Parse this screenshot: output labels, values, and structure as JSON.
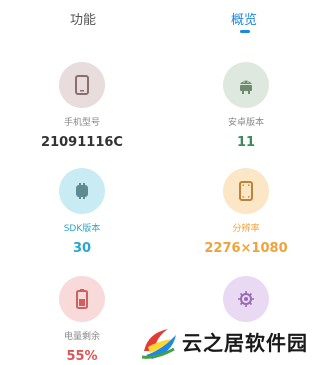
{
  "tabs": [
    {
      "label": "功能",
      "active": false
    },
    {
      "label": "概览",
      "active": true
    }
  ],
  "accent_color": "#1e88e5",
  "items": [
    {
      "id": "model",
      "label": "手机型号",
      "value": "21091116C",
      "icon": "phone-icon",
      "circle_color": "#e8dcdc",
      "icon_color": "#8a6f6f",
      "value_color": "#333333"
    },
    {
      "id": "android",
      "label": "安卓版本",
      "value": "11",
      "icon": "android-icon",
      "circle_color": "#dfe8df",
      "icon_color": "#6f8a6f",
      "value_color": "#3d8a5a"
    },
    {
      "id": "sdk",
      "label": "SDK版本",
      "value": "30",
      "icon": "sdk-icon",
      "circle_color": "#c9ecf4",
      "icon_color": "#5f8a92",
      "value_color": "#2aa7c9"
    },
    {
      "id": "resolution",
      "label": "分辨率",
      "value": "2276×1080",
      "icon": "screen-icon",
      "circle_color": "#fbe6c6",
      "icon_color": "#b9853a",
      "value_color": "#f0a23a"
    },
    {
      "id": "battery",
      "label": "电量剩余",
      "value": "55%",
      "icon": "battery-icon",
      "circle_color": "#f8dada",
      "icon_color": "#d06060",
      "value_color": "#e05454"
    },
    {
      "id": "cpu",
      "label": "",
      "value": "",
      "icon": "cpu-icon",
      "circle_color": "#ead9f2",
      "icon_color": "#9a6bb3",
      "value_color": "#9a6bb3"
    }
  ],
  "watermark": {
    "text": "云之居软件园",
    "icon": "watermark-logo-icon"
  }
}
